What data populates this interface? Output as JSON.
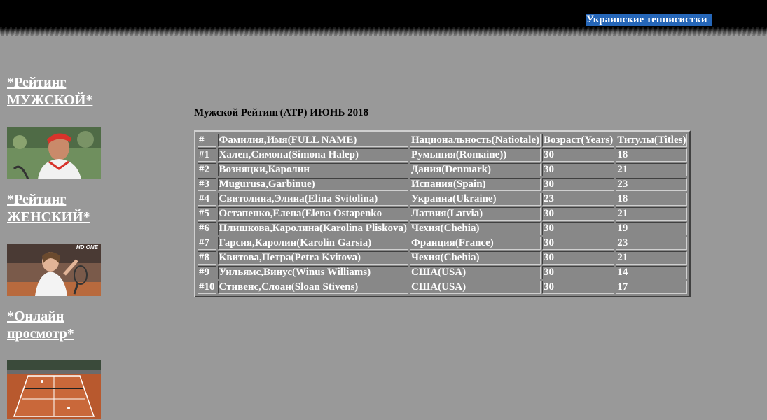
{
  "header": {
    "link_label": "Украинские теннисистки"
  },
  "sidebar": {
    "items": [
      {
        "label": "*Рейтинг МУЖСКОЙ*",
        "image": "rafael-nadal-photo"
      },
      {
        "label": "*Рейтинг ЖЕНСКИЙ*",
        "image": "elina-svitolina-photo"
      },
      {
        "label": "*Онлайн просмотр*",
        "image": "tennis-court-broadcast-photo"
      }
    ]
  },
  "main": {
    "title": "Мужской Рейтинг(ATP) ИЮНЬ 2018",
    "table": {
      "headers": [
        "#",
        "Фамилия,Имя(FULL NAME)",
        "Национальность(Natiotale)",
        "Возраст(Years)",
        "Титулы(Titles)"
      ],
      "rows": [
        [
          "#1",
          "Халеп,Симона(Simona Halep)",
          "Румыния(Romaine))",
          "30",
          "18"
        ],
        [
          "#2",
          "Возняцки,Каролин",
          "Дания(Denmark)",
          "30",
          "21"
        ],
        [
          "#3",
          "Mugurusa,Garbinue)",
          "Испания(Spain)",
          "30",
          "23"
        ],
        [
          "#4",
          "Свитолина,Элина(Elina Svitolina)",
          "Украина(Ukraine)",
          "23",
          "18"
        ],
        [
          "#5",
          "Остапенко,Елена(Elena Ostapenko",
          "Латвия(Latvia)",
          "30",
          "21"
        ],
        [
          "#6",
          "Плишкова,Каролина(Karolina Pliskova)",
          "Чехия(Chehia)",
          "30",
          "19"
        ],
        [
          "#7",
          "Гарсия,Каролин(Karolin Garsia)",
          "Франция(France)",
          "30",
          "23"
        ],
        [
          "#8",
          "Квитова,Петра(Petra Kvitova)",
          "Чехия(Chehia)",
          "30",
          "21"
        ],
        [
          "#9",
          "Уильямс,Винус(Winus Williams)",
          "США(USA)",
          "30",
          "14"
        ],
        [
          "#10",
          "Стивенс,Слоан(Sloan Stivens)",
          "США(USA)",
          "30",
          "17"
        ]
      ]
    }
  },
  "thumb_overlay_text": "HD ONE"
}
